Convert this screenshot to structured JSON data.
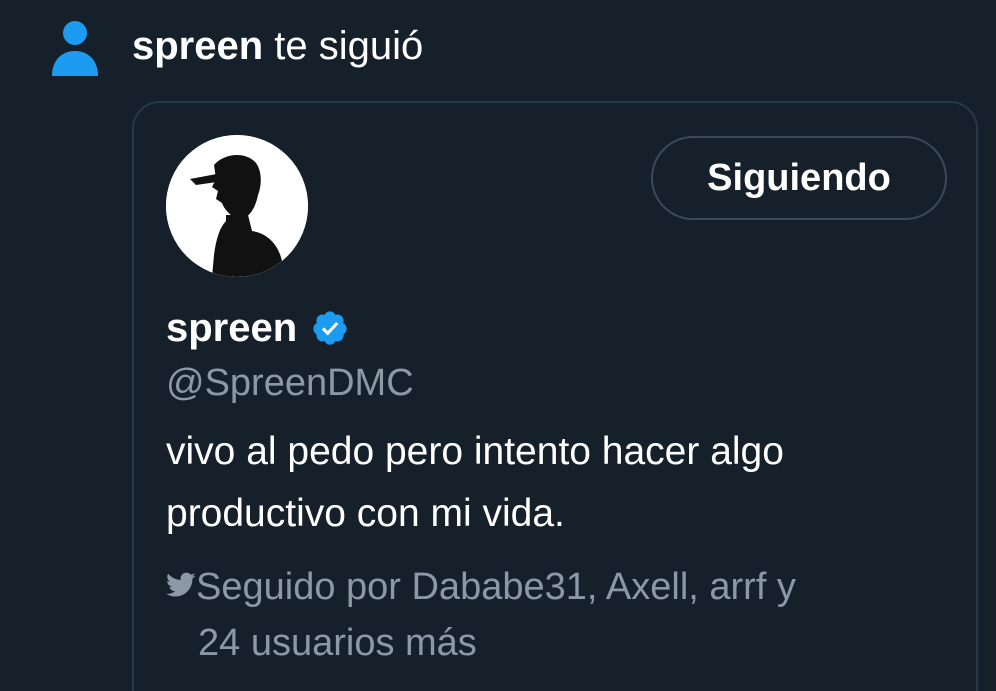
{
  "notification": {
    "icon": "person-icon",
    "actor": "spreen",
    "action": " te siguió"
  },
  "profile_card": {
    "avatar": "avatar-silhouette",
    "follow_button_label": "Siguiendo",
    "display_name": "spreen",
    "verified_icon": "verified-badge-icon",
    "handle": "@SpreenDMC",
    "bio": "vivo al pedo pero intento hacer algo productivo con mi vida.",
    "followed_by_icon": "bird-icon",
    "followed_by_line1": "Seguido por Dababe31, Axell, arrf y",
    "followed_by_line2": "24 usuarios más"
  },
  "colors": {
    "background": "#15202b",
    "accent": "#1d9bf0",
    "secondary_text": "#8b98a5",
    "border": "#273847"
  }
}
